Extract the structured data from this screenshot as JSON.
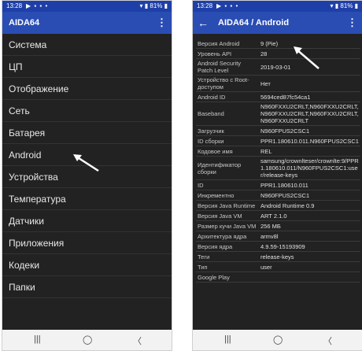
{
  "left": {
    "status": {
      "time": "13:28",
      "dots": "▶ ▪ ▪ •",
      "right": "▾ ▮ 81% ▮"
    },
    "title": "AIDA64",
    "menu_items": [
      "Система",
      "ЦП",
      "Отображение",
      "Сеть",
      "Батарея",
      "Android",
      "Устройства",
      "Температура",
      "Датчики",
      "Приложения",
      "Кодеки",
      "Папки"
    ]
  },
  "right": {
    "status": {
      "time": "13:28",
      "dots": "▶ ▪ ▪ •",
      "right": "▾ ▮ 81% ▮"
    },
    "title": "AIDA64  /  Android",
    "rows": [
      {
        "k": "Версия Android",
        "v": "9 (Pie)"
      },
      {
        "k": "Уровень API",
        "v": "28"
      },
      {
        "k": "Android Security Patch Level",
        "v": "2019-03-01"
      },
      {
        "k": "Устройство с Root-доступом",
        "v": "Нет"
      },
      {
        "k": "Android ID",
        "v": "5694ced87fc54ca1"
      },
      {
        "k": "Baseband",
        "v": "N960FXXU2CRLT,N960FXXU2CRLT,N960FXXU2CRLT,N960FXXU2CRLT,N960FXXU2CRLT"
      },
      {
        "k": "Загрузчик",
        "v": "N960FPUS2CSC1"
      },
      {
        "k": "ID сборки",
        "v": "PPR1.180610.011.N960FPUS2CSC1"
      },
      {
        "k": "Кодовое имя",
        "v": "REL"
      },
      {
        "k": "Идентификатор сборки",
        "v": "samsung/crownlteser/crownlte:9/PPR1.180610.011/N960FPUS2CSC1:user/release-keys"
      },
      {
        "k": "ID",
        "v": "PPR1.180610.011"
      },
      {
        "k": "Инкрементно",
        "v": "N960FPUS2CSC1"
      },
      {
        "k": "Версия Java Runtime",
        "v": "Android Runtime 0.9"
      },
      {
        "k": "Версия Java VM",
        "v": "ART 2.1.0"
      },
      {
        "k": "Размер кучи Java VM",
        "v": "256 МБ"
      },
      {
        "k": "Архитектура ядра",
        "v": "armv8l"
      },
      {
        "k": "Версия ядра",
        "v": "4.9.59-15193909"
      },
      {
        "k": "Теги",
        "v": "release-keys"
      },
      {
        "k": "Тип",
        "v": "user"
      },
      {
        "k": "Google Play",
        "v": ""
      }
    ]
  },
  "nav": {
    "recents": "|||",
    "home": "◯",
    "back": "〈"
  },
  "icons": {
    "menu": "⋮",
    "back": "←"
  }
}
